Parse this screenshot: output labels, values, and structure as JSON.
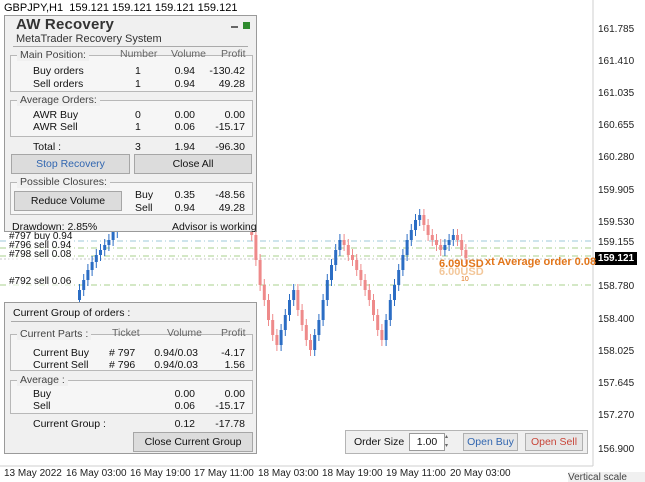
{
  "chart": {
    "title": "GBPJPY,H1  159.121 159.121 159.121 159.121",
    "price_labels": [
      "161.785",
      "161.410",
      "161.035",
      "160.655",
      "160.280",
      "159.905",
      "159.530",
      "159.155",
      "158.780",
      "158.400",
      "158.025",
      "157.645",
      "157.270",
      "156.900"
    ],
    "current_price": "159.121",
    "time_labels": [
      "13 May 2022",
      "16 May 03:00",
      "16 May 19:00",
      "17 May 11:00",
      "18 May 03:00",
      "18 May 19:00",
      "19 May 11:00",
      "20 May 03:00"
    ],
    "vertical_scale": "Vertical scale",
    "order_lines": [
      "#797 buy 0.94",
      "#796 sell 0.94",
      "#798 sell 0.08",
      "#792 sell 0.06"
    ],
    "annotation_profit": "6.09USD",
    "annotation_profit_shadow": "6.00USD",
    "annotation_next": "xt Average order 0.08",
    "annotation_small": "10",
    "colors": {
      "bull": "#2b6dc4",
      "bear": "#ee8a8a",
      "buyline": "#9ec9d8",
      "sellline": "#a8d08d",
      "annotation": "#e2761b"
    }
  },
  "recovery": {
    "title": "AW Recovery",
    "subtitle": "MetaTrader Recovery System",
    "main_position": {
      "legend": "Main Position:",
      "headers": [
        "Number",
        "Volume",
        "Profit"
      ],
      "rows": [
        {
          "label": "Buy orders",
          "number": "1",
          "volume": "0.94",
          "profit": "-130.42"
        },
        {
          "label": "Sell orders",
          "number": "1",
          "volume": "0.94",
          "profit": "49.28"
        }
      ]
    },
    "average_orders": {
      "legend": "Average Orders:",
      "rows": [
        {
          "label": "AWR Buy",
          "number": "0",
          "volume": "0.00",
          "profit": "0.00"
        },
        {
          "label": "AWR Sell",
          "number": "1",
          "volume": "0.06",
          "profit": "-15.17"
        }
      ]
    },
    "total": {
      "label": "Total :",
      "number": "3",
      "volume": "1.94",
      "profit": "-96.30"
    },
    "stop_recovery_label": "Stop Recovery",
    "close_all_label": "Close All",
    "possible_closures": {
      "legend": "Possible Closures:",
      "reduce_volume_label": "Reduce Volume",
      "rows": [
        {
          "label": "Buy",
          "volume": "0.35",
          "profit": "-48.56"
        },
        {
          "label": "Sell",
          "volume": "0.94",
          "profit": "49.28"
        }
      ]
    },
    "drawdown": "Drawdown: 2.85%",
    "status": "Advisor is working"
  },
  "current_group": {
    "title": "Current Group of orders :",
    "parts": {
      "legend": "Current Parts :",
      "headers": [
        "Ticket",
        "Volume",
        "Profit"
      ],
      "rows": [
        {
          "label": "Current Buy",
          "ticket": "# 797",
          "volume": "0.94/0.03",
          "profit": "-4.17"
        },
        {
          "label": "Current Sell",
          "ticket": "# 796",
          "volume": "0.94/0.03",
          "profit": "1.56"
        }
      ]
    },
    "average": {
      "legend": "Average :",
      "rows": [
        {
          "label": "Buy",
          "volume": "0.00",
          "profit": "0.00"
        },
        {
          "label": "Sell",
          "volume": "0.06",
          "profit": "-15.17"
        }
      ]
    },
    "group_total": {
      "label": "Current Group :",
      "volume": "0.12",
      "profit": "-17.78"
    },
    "close_button_label": "Close Current Group"
  },
  "order_panel": {
    "size_label": "Order Size",
    "size_value": "1.00",
    "open_buy_label": "Open Buy",
    "open_sell_label": "Open Sell"
  }
}
